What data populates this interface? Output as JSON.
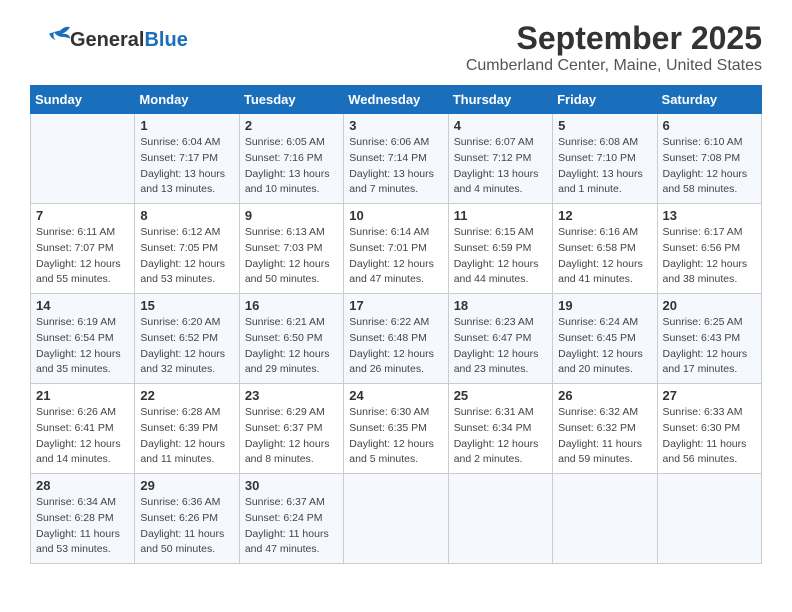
{
  "header": {
    "logo_general": "General",
    "logo_blue": "Blue",
    "month": "September 2025",
    "location": "Cumberland Center, Maine, United States"
  },
  "weekdays": [
    "Sunday",
    "Monday",
    "Tuesday",
    "Wednesday",
    "Thursday",
    "Friday",
    "Saturday"
  ],
  "weeks": [
    [
      {
        "day": "",
        "info": ""
      },
      {
        "day": "1",
        "info": "Sunrise: 6:04 AM\nSunset: 7:17 PM\nDaylight: 13 hours\nand 13 minutes."
      },
      {
        "day": "2",
        "info": "Sunrise: 6:05 AM\nSunset: 7:16 PM\nDaylight: 13 hours\nand 10 minutes."
      },
      {
        "day": "3",
        "info": "Sunrise: 6:06 AM\nSunset: 7:14 PM\nDaylight: 13 hours\nand 7 minutes."
      },
      {
        "day": "4",
        "info": "Sunrise: 6:07 AM\nSunset: 7:12 PM\nDaylight: 13 hours\nand 4 minutes."
      },
      {
        "day": "5",
        "info": "Sunrise: 6:08 AM\nSunset: 7:10 PM\nDaylight: 13 hours\nand 1 minute."
      },
      {
        "day": "6",
        "info": "Sunrise: 6:10 AM\nSunset: 7:08 PM\nDaylight: 12 hours\nand 58 minutes."
      }
    ],
    [
      {
        "day": "7",
        "info": "Sunrise: 6:11 AM\nSunset: 7:07 PM\nDaylight: 12 hours\nand 55 minutes."
      },
      {
        "day": "8",
        "info": "Sunrise: 6:12 AM\nSunset: 7:05 PM\nDaylight: 12 hours\nand 53 minutes."
      },
      {
        "day": "9",
        "info": "Sunrise: 6:13 AM\nSunset: 7:03 PM\nDaylight: 12 hours\nand 50 minutes."
      },
      {
        "day": "10",
        "info": "Sunrise: 6:14 AM\nSunset: 7:01 PM\nDaylight: 12 hours\nand 47 minutes."
      },
      {
        "day": "11",
        "info": "Sunrise: 6:15 AM\nSunset: 6:59 PM\nDaylight: 12 hours\nand 44 minutes."
      },
      {
        "day": "12",
        "info": "Sunrise: 6:16 AM\nSunset: 6:58 PM\nDaylight: 12 hours\nand 41 minutes."
      },
      {
        "day": "13",
        "info": "Sunrise: 6:17 AM\nSunset: 6:56 PM\nDaylight: 12 hours\nand 38 minutes."
      }
    ],
    [
      {
        "day": "14",
        "info": "Sunrise: 6:19 AM\nSunset: 6:54 PM\nDaylight: 12 hours\nand 35 minutes."
      },
      {
        "day": "15",
        "info": "Sunrise: 6:20 AM\nSunset: 6:52 PM\nDaylight: 12 hours\nand 32 minutes."
      },
      {
        "day": "16",
        "info": "Sunrise: 6:21 AM\nSunset: 6:50 PM\nDaylight: 12 hours\nand 29 minutes."
      },
      {
        "day": "17",
        "info": "Sunrise: 6:22 AM\nSunset: 6:48 PM\nDaylight: 12 hours\nand 26 minutes."
      },
      {
        "day": "18",
        "info": "Sunrise: 6:23 AM\nSunset: 6:47 PM\nDaylight: 12 hours\nand 23 minutes."
      },
      {
        "day": "19",
        "info": "Sunrise: 6:24 AM\nSunset: 6:45 PM\nDaylight: 12 hours\nand 20 minutes."
      },
      {
        "day": "20",
        "info": "Sunrise: 6:25 AM\nSunset: 6:43 PM\nDaylight: 12 hours\nand 17 minutes."
      }
    ],
    [
      {
        "day": "21",
        "info": "Sunrise: 6:26 AM\nSunset: 6:41 PM\nDaylight: 12 hours\nand 14 minutes."
      },
      {
        "day": "22",
        "info": "Sunrise: 6:28 AM\nSunset: 6:39 PM\nDaylight: 12 hours\nand 11 minutes."
      },
      {
        "day": "23",
        "info": "Sunrise: 6:29 AM\nSunset: 6:37 PM\nDaylight: 12 hours\nand 8 minutes."
      },
      {
        "day": "24",
        "info": "Sunrise: 6:30 AM\nSunset: 6:35 PM\nDaylight: 12 hours\nand 5 minutes."
      },
      {
        "day": "25",
        "info": "Sunrise: 6:31 AM\nSunset: 6:34 PM\nDaylight: 12 hours\nand 2 minutes."
      },
      {
        "day": "26",
        "info": "Sunrise: 6:32 AM\nSunset: 6:32 PM\nDaylight: 11 hours\nand 59 minutes."
      },
      {
        "day": "27",
        "info": "Sunrise: 6:33 AM\nSunset: 6:30 PM\nDaylight: 11 hours\nand 56 minutes."
      }
    ],
    [
      {
        "day": "28",
        "info": "Sunrise: 6:34 AM\nSunset: 6:28 PM\nDaylight: 11 hours\nand 53 minutes."
      },
      {
        "day": "29",
        "info": "Sunrise: 6:36 AM\nSunset: 6:26 PM\nDaylight: 11 hours\nand 50 minutes."
      },
      {
        "day": "30",
        "info": "Sunrise: 6:37 AM\nSunset: 6:24 PM\nDaylight: 11 hours\nand 47 minutes."
      },
      {
        "day": "",
        "info": ""
      },
      {
        "day": "",
        "info": ""
      },
      {
        "day": "",
        "info": ""
      },
      {
        "day": "",
        "info": ""
      }
    ]
  ]
}
